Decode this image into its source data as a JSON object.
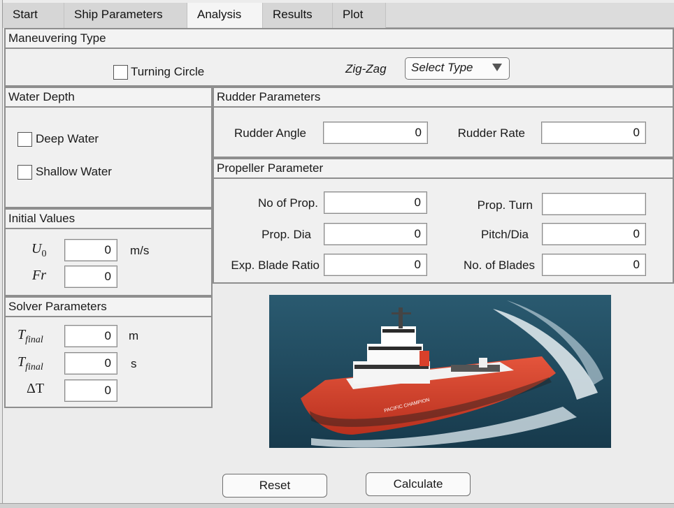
{
  "tabs": [
    {
      "label": "Start"
    },
    {
      "label": "Ship Parameters"
    },
    {
      "label": "Analysis"
    },
    {
      "label": "Results"
    },
    {
      "label": "Plot"
    }
  ],
  "active_tab": "Analysis",
  "maneuvering": {
    "title": "Maneuvering Type",
    "turning_circle_label": "Turning Circle",
    "zigzag_label": "Zig-Zag",
    "select_value": "Select Type"
  },
  "water_depth": {
    "title": "Water Depth",
    "deep_label": "Deep Water",
    "shallow_label": "Shallow Water"
  },
  "initial_values": {
    "title": "Initial Values",
    "u0_symbol": "U",
    "u0_sub": "0",
    "u0_value": "0",
    "u0_unit": "m/s",
    "fr_symbol": "Fr",
    "fr_value": "0"
  },
  "solver": {
    "title": "Solver Parameters",
    "t1_symbol": "T",
    "t1_sub": "final",
    "t1_value": "0",
    "t1_unit": "m",
    "t2_symbol": "T",
    "t2_sub": "final",
    "t2_value": "0",
    "t2_unit": "s",
    "dt_symbol": "ΔT",
    "dt_value": "0"
  },
  "rudder": {
    "title": "Rudder Parameters",
    "angle_label": "Rudder Angle",
    "angle_value": "0",
    "rate_label": "Rudder Rate",
    "rate_value": "0"
  },
  "propeller": {
    "title": "Propeller Parameter",
    "num_label": "No of Prop.",
    "num_value": "0",
    "turn_label": "Prop. Turn",
    "turn_value": "",
    "dia_label": "Prop. Dia",
    "dia_value": "0",
    "pitch_label": "Pitch/Dia",
    "pitch_value": "0",
    "ebr_label": "Exp. Blade Ratio",
    "ebr_value": "0",
    "blades_label": "No. of Blades",
    "blades_value": "0"
  },
  "ship_name_text": "PACIFIC CHAMPION",
  "buttons": {
    "reset": "Reset",
    "calculate": "Calculate"
  },
  "colors": {
    "hull_red": "#d9402a",
    "sea": "#1e4a5f",
    "accent_border": "#8e8e8e"
  }
}
